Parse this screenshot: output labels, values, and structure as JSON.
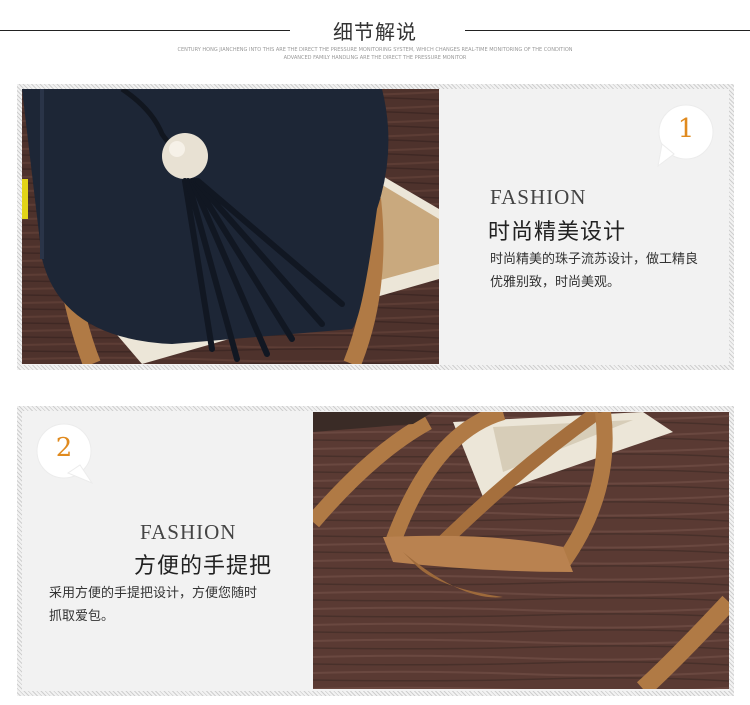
{
  "header": {
    "title": "细节解说",
    "subtitle_line1": "CENTURY HONG JIANCHENG INTO THIS ARE THE DIRECT THE PRESSURE MONITORING SYSTEM, WHICH CHANGES REAL-TIME MONITORING OF THE CONDITION",
    "subtitle_line2": "ADVANCED FAMILY HANDLING ARE THE DIRECT THE PRESSURE MONITOR"
  },
  "sections": [
    {
      "number": "1",
      "fashion_label": "FASHION",
      "heading": "时尚精美设计",
      "description_line1": "时尚精美的珠子流苏设计，做工精良",
      "description_line2": "优雅别致，时尚美观。"
    },
    {
      "number": "2",
      "fashion_label": "FASHION",
      "heading": "方便的手提把",
      "description_line1": "采用方便的手提把设计，方便您随时",
      "description_line2": "抓取爱包。"
    }
  ],
  "colors": {
    "accent": "#e08a1e",
    "bag": "#1d2636",
    "strap": "#b07a45",
    "wood": "#5a3a33"
  }
}
